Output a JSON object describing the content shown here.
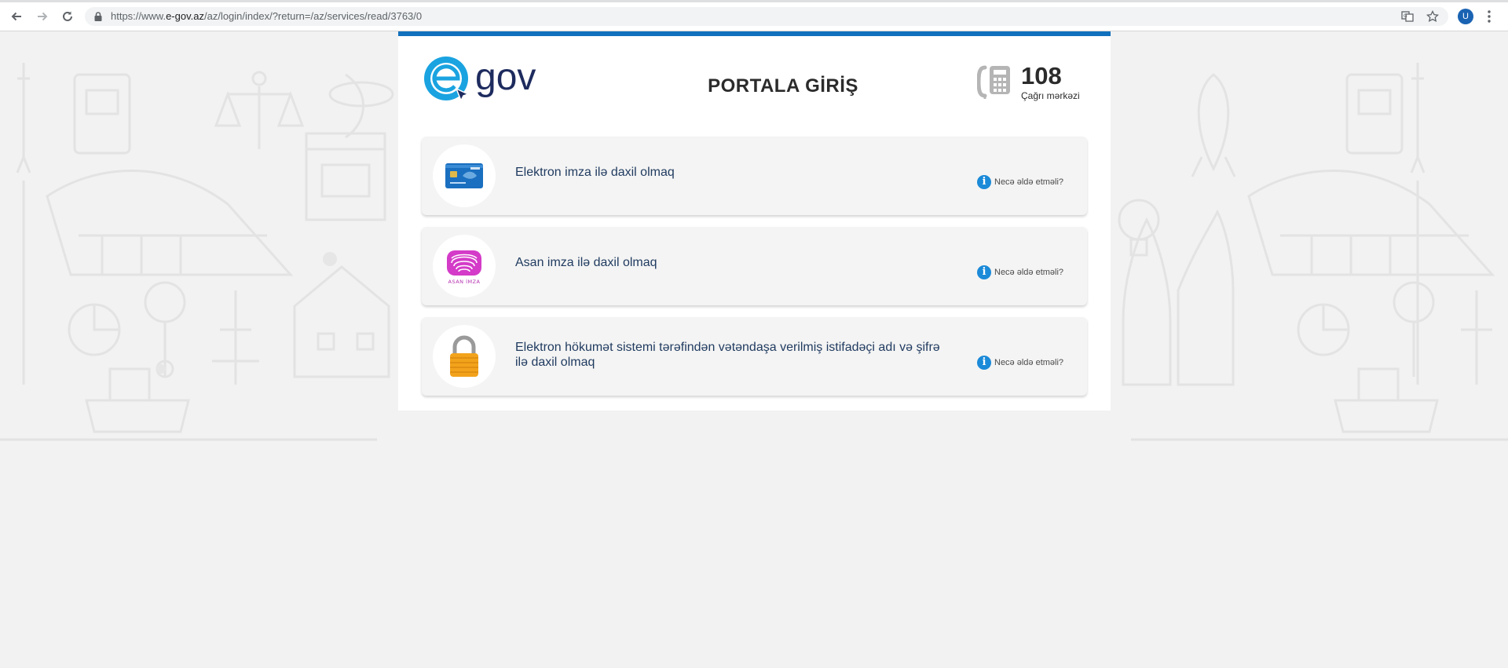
{
  "browser": {
    "url_prefix": "https://www.",
    "url_host": "e-gov.az",
    "url_path": "/az/login/index/?return=/az/services/read/3763/0",
    "profile_initial": "U",
    "icons": [
      "back-arrow-icon",
      "forward-arrow-icon",
      "reload-icon",
      "lock-icon",
      "translate-icon",
      "star-icon",
      "menu-dots-icon"
    ]
  },
  "header": {
    "logo_text": "gov",
    "title": "PORTALA GİRİŞ",
    "call_center_number": "108",
    "call_center_label": "Çağrı mərkəzi"
  },
  "options": [
    {
      "icon": "electronic-signature-card-icon",
      "label": "Elektron imza ilə daxil olmaq",
      "help": "Necə əldə etməli?"
    },
    {
      "icon": "asan-imza-fingerprint-icon",
      "label": "Asan imza ilə daxil olmaq",
      "icon_caption": "ASAN İMZA",
      "help": "Necə əldə etməli?"
    },
    {
      "icon": "padlock-icon",
      "label": "Elektron hökumət sistemi tərəfindən vətəndaşa verilmiş istifadəçi adı və şifrə ilə daxil olmaq",
      "help": "Necə əldə etməli?"
    }
  ],
  "colors": {
    "accent_blue": "#1271bd",
    "logo_cyan": "#1aa3e0",
    "logo_navy": "#1d2b5e",
    "info_blue": "#1b8ad8",
    "page_background": "#f2f2f2"
  }
}
